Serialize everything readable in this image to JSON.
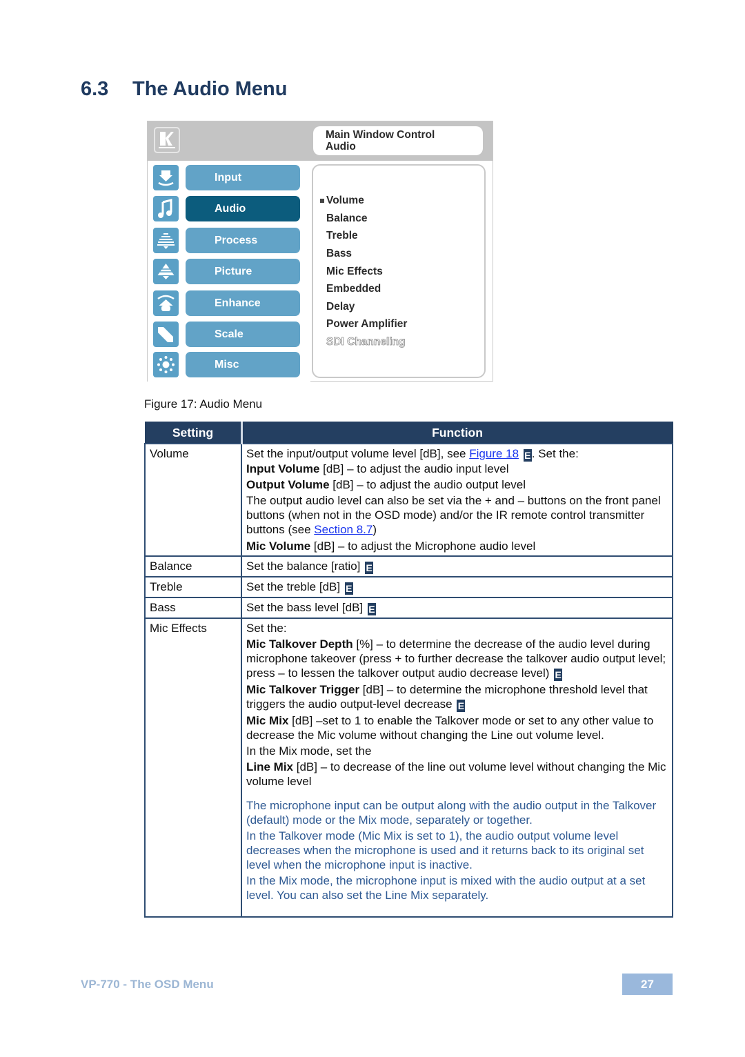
{
  "section": {
    "number": "6.3",
    "title": "The Audio Menu"
  },
  "osd": {
    "logo": "kramer-logo",
    "title_line1": "Main Window Control",
    "title_line2": "Audio",
    "nav": [
      {
        "label": "Input",
        "icon": "input-icon",
        "active": false
      },
      {
        "label": "Audio",
        "icon": "music-note-icon",
        "active": true
      },
      {
        "label": "Process",
        "icon": "process-icon",
        "active": false
      },
      {
        "label": "Picture",
        "icon": "picture-icon",
        "active": false
      },
      {
        "label": "Enhance",
        "icon": "enhance-icon",
        "active": false
      },
      {
        "label": "Scale",
        "icon": "scale-icon",
        "active": false
      },
      {
        "label": "Misc",
        "icon": "misc-icon",
        "active": false
      }
    ],
    "items": [
      {
        "label": "Volume",
        "state": "selected"
      },
      {
        "label": "Balance",
        "state": "normal"
      },
      {
        "label": "Treble",
        "state": "normal"
      },
      {
        "label": "Bass",
        "state": "normal"
      },
      {
        "label": "Mic Effects",
        "state": "normal"
      },
      {
        "label": "Embedded",
        "state": "normal"
      },
      {
        "label": "Delay",
        "state": "normal"
      },
      {
        "label": "Power Amplifier",
        "state": "normal"
      },
      {
        "label": "SDI Channeling",
        "state": "disabled"
      }
    ]
  },
  "caption": "Figure 17: Audio Menu",
  "table": {
    "headers": [
      "Setting",
      "Function"
    ],
    "badge": "E",
    "volume": {
      "setting": "Volume",
      "l1_pre": "Set the input/output volume level [dB], see ",
      "l1_link": "Figure 18",
      "l1_post": ". Set the:",
      "l2_b": "Input Volume",
      "l2": " [dB] – to adjust the audio input level",
      "l3_b": "Output Volume",
      "l3": " [dB] – to adjust the audio output level",
      "l4_pre": "The output audio level can also be set via the + and – buttons on the front panel buttons (when not in the OSD mode) and/or the IR remote control transmitter buttons (see ",
      "l4_link": "Section 8.7",
      "l4_post": ")",
      "l5_b": "Mic Volume",
      "l5": " [dB] – to adjust the Microphone audio level"
    },
    "balance": {
      "setting": "Balance",
      "func": "Set the balance [ratio] "
    },
    "treble": {
      "setting": "Treble",
      "func": "Set the treble [dB] "
    },
    "bass": {
      "setting": "Bass",
      "func": "Set the bass level [dB] "
    },
    "mic": {
      "setting": "Mic Effects",
      "l1": "Set the:",
      "l2_b": "Mic Talkover Depth",
      "l2": " [%] – to determine the decrease of the audio level during microphone takeover (press + to further decrease the talkover audio output level; press – to lessen the talkover output audio decrease level) ",
      "l3_b": "Mic Talkover Trigger",
      "l3": " [dB] – to determine the microphone threshold level that triggers the audio output-level decrease ",
      "l4_b": "Mic Mix",
      "l4": " [dB] –set to 1 to enable the Talkover mode or set to any other value to decrease the Mic volume without changing the Line out volume level.",
      "l5": "In the Mix mode, set the",
      "l6_b": "Line Mix",
      "l6": " [dB] – to decrease of the line out volume level without changing the Mic volume level",
      "note1": "The microphone input can be output along with the audio output in the Talkover (default) mode or the Mix mode, separately or together.",
      "note2": "In the Talkover mode (Mic Mix is set to 1), the audio output volume level decreases when the microphone is used and it returns back to its original set level when the microphone input is inactive.",
      "note3": "In the Mix mode, the microphone input is mixed with the audio output at a set level. You can also set the Line Mix separately."
    }
  },
  "footer": {
    "left": "VP-770 - The OSD Menu",
    "page": "27"
  },
  "colors": {
    "heading": "#1f3a5f",
    "table_header": "#243f61",
    "nav_button": "#62a3c7",
    "nav_active": "#0c5c7d",
    "note_text": "#2f5a93",
    "footer_text": "#9cb6d4",
    "page_badge": "#9ab8dc"
  }
}
